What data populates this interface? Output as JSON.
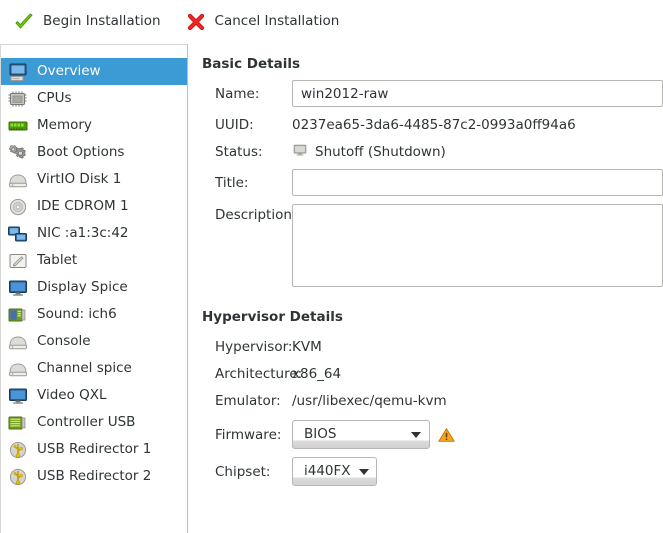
{
  "toolbar": {
    "begin_label": "Begin Installation",
    "begin_icon": "green-check-icon",
    "cancel_label": "Cancel Installation",
    "cancel_icon": "red-x-icon"
  },
  "sidebar": {
    "selected_index": 0,
    "selected_bg": "#3c9bd4",
    "items": [
      {
        "label": "Overview",
        "icon": "computer-icon"
      },
      {
        "label": "CPUs",
        "icon": "cpu-chip-icon"
      },
      {
        "label": "Memory",
        "icon": "memory-stick-icon"
      },
      {
        "label": "Boot Options",
        "icon": "gears-icon"
      },
      {
        "label": "VirtIO Disk 1",
        "icon": "harddisk-icon"
      },
      {
        "label": "IDE CDROM 1",
        "icon": "optical-disc-icon"
      },
      {
        "label": "NIC :a1:3c:42",
        "icon": "network-card-icon"
      },
      {
        "label": "Tablet",
        "icon": "tablet-pen-icon"
      },
      {
        "label": "Display Spice",
        "icon": "display-monitor-icon"
      },
      {
        "label": "Sound: ich6",
        "icon": "sound-card-icon"
      },
      {
        "label": "Console",
        "icon": "console-icon"
      },
      {
        "label": "Channel spice",
        "icon": "channel-icon"
      },
      {
        "label": "Video QXL",
        "icon": "video-monitor-icon"
      },
      {
        "label": "Controller USB",
        "icon": "controller-card-icon"
      },
      {
        "label": "USB Redirector 1",
        "icon": "usb-redirector-icon"
      },
      {
        "label": "USB Redirector 2",
        "icon": "usb-redirector-icon"
      }
    ]
  },
  "basic_details": {
    "title": "Basic Details",
    "name_label": "Name:",
    "name_value": "win2012-raw",
    "uuid_label": "UUID:",
    "uuid_value": "0237ea65-3da6-4485-87c2-0993a0ff94a6",
    "status_label": "Status:",
    "status_value": "Shutoff (Shutdown)",
    "status_icon": "shutoff-monitor-icon",
    "title_label": "Title:",
    "title_value": "",
    "description_label": "Description:",
    "description_value": ""
  },
  "hypervisor_details": {
    "title": "Hypervisor Details",
    "hypervisor_label": "Hypervisor:",
    "hypervisor_value": "KVM",
    "architecture_label": "Architecture:",
    "architecture_value": "x86_64",
    "emulator_label": "Emulator:",
    "emulator_value": "/usr/libexec/qemu-kvm",
    "firmware_label": "Firmware:",
    "firmware_value": "BIOS",
    "firmware_warning_icon": "warning-triangle-icon",
    "firmware_warning_color": "#f57900",
    "chipset_label": "Chipset:",
    "chipset_value": "i440FX"
  }
}
